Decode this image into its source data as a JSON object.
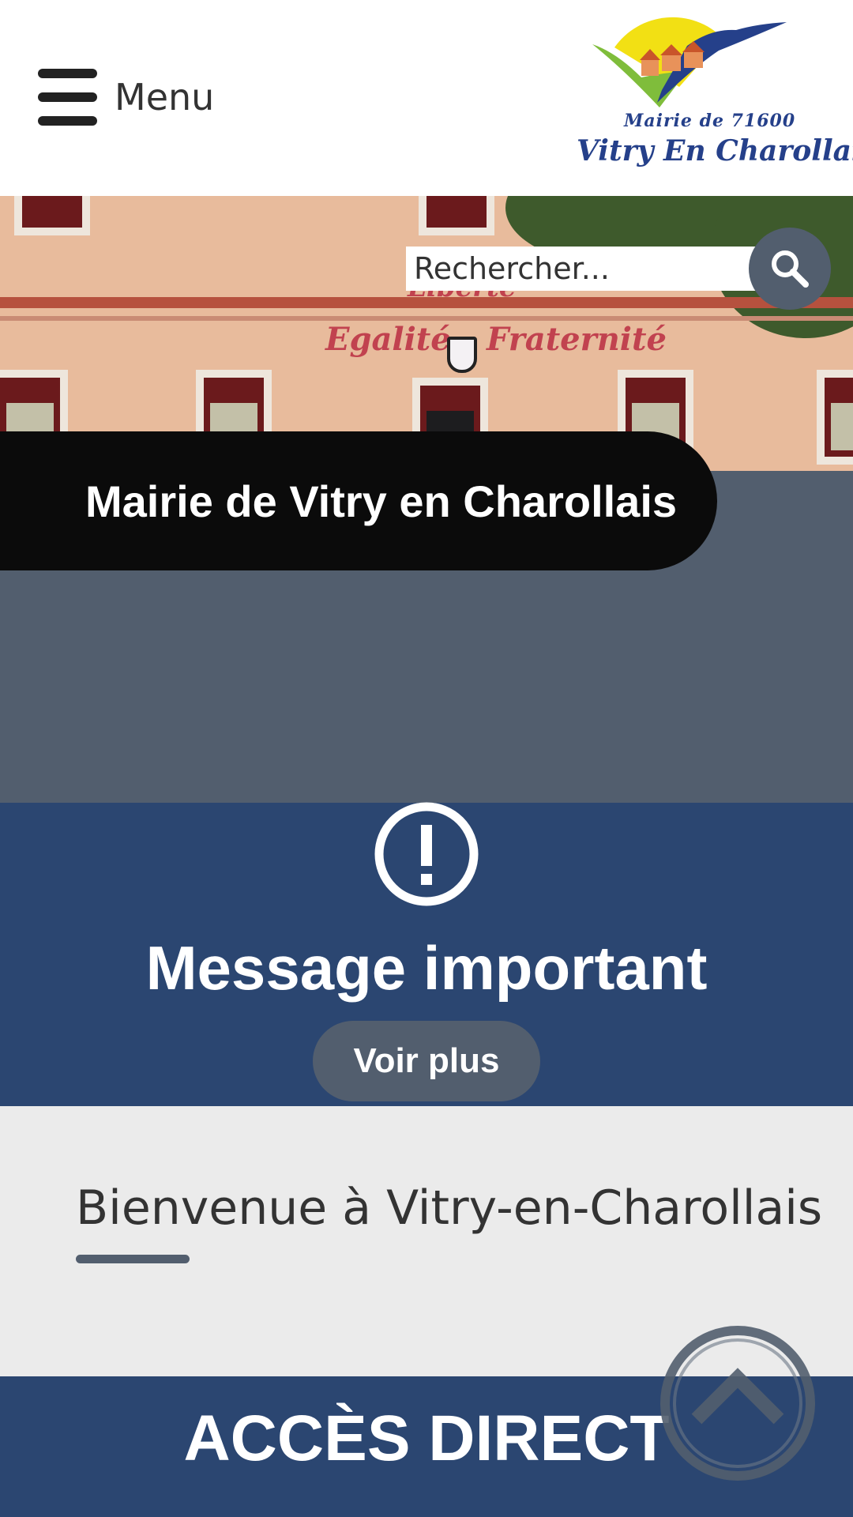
{
  "header": {
    "menu_label": "Menu",
    "logo_line1": "Mairie de 71600",
    "logo_line2": "Vitry En Charollais"
  },
  "hero": {
    "motto_top": "Liberté",
    "motto_left": "Egalité",
    "motto_right": "Fraternité",
    "title": "Mairie de Vitry en Charollais"
  },
  "search": {
    "placeholder": "Rechercher..."
  },
  "message": {
    "icon": "exclamation-circle-icon",
    "title": "Message important",
    "button_label": "Voir plus"
  },
  "welcome": {
    "title": "Bienvenue à Vitry-en-Charollais"
  },
  "acces": {
    "title": "ACCÈS DIRECT"
  },
  "colors": {
    "navy": "#2b4671",
    "slate": "#525e6e",
    "logo_blue": "#25408a"
  }
}
